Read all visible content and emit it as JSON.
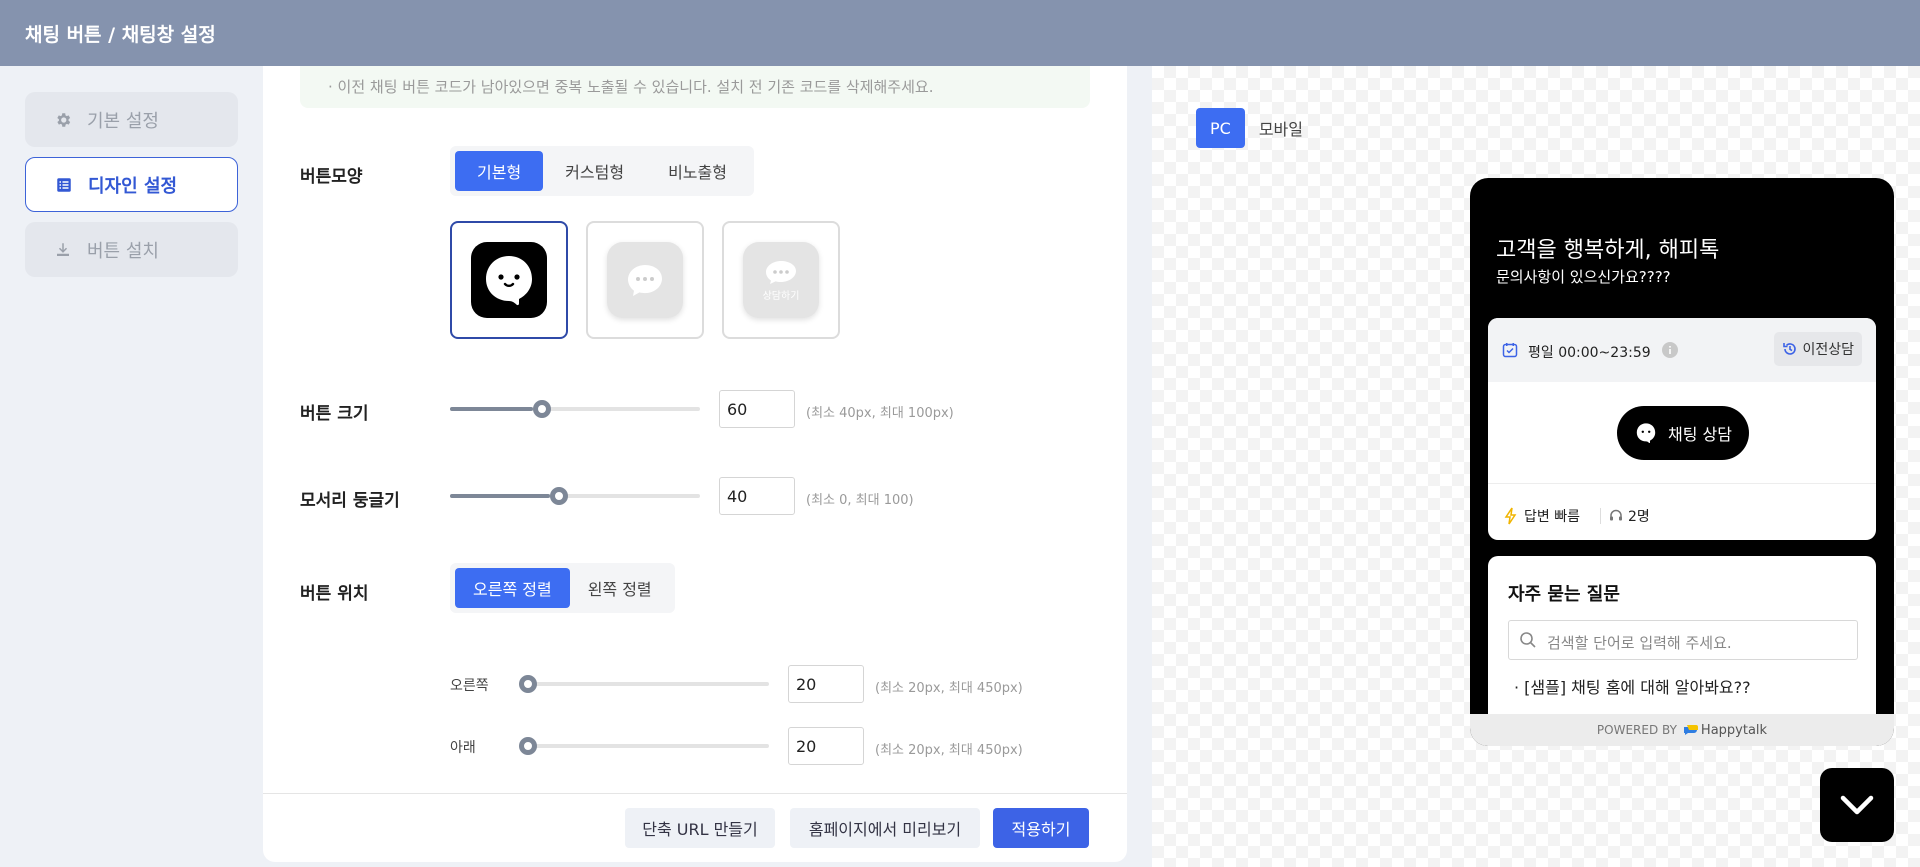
{
  "header": {
    "title": "채팅 버튼 / 채팅창 설정"
  },
  "nav": {
    "items": [
      {
        "label": "기본 설정"
      },
      {
        "label": "디자인 설정"
      },
      {
        "label": "버튼 설치"
      }
    ]
  },
  "notice": {
    "text": "· 이전 채팅 버튼 코드가 남아있으면 중복 노출될 수 있습니다. 설치 전 기존 코드를 삭제해주세요."
  },
  "button_shape": {
    "label": "버튼모양",
    "options": [
      "기본형",
      "커스텀형",
      "비노출형"
    ],
    "selected": "기본형",
    "card_text": "상담하기"
  },
  "button_size": {
    "label": "버튼 크기",
    "value": "60",
    "level": 0.33,
    "hint": "(최소 40px, 최대 100px)"
  },
  "corner_radius": {
    "label": "모서리 둥글기",
    "value": "40",
    "level": 0.4,
    "hint": "(최소 0, 최대 100)"
  },
  "button_position": {
    "label": "버튼 위치",
    "options": [
      "오른쪽 정렬",
      "왼쪽 정렬"
    ],
    "selected": "오른쪽 정렬",
    "right": {
      "label": "오른쪽",
      "value": "20",
      "level": 0.0,
      "hint": "(최소 20px, 최대 450px)"
    },
    "bottom": {
      "label": "아래",
      "value": "20",
      "level": 0.0,
      "hint": "(최소 20px, 최대 450px)"
    }
  },
  "footer": {
    "short_url_label": "단축 URL 만들기",
    "preview_label": "홈페이지에서 미리보기",
    "apply_label": "적용하기"
  },
  "preview": {
    "tabs": [
      "PC",
      "모바일"
    ],
    "widget": {
      "title": "고객을 행복하게, 해피톡",
      "subtitle": "문의사항이 있으신가요????",
      "hours": "평일 00:00~23:59",
      "history_label": "이전상담",
      "chat_button": "채팅 상담",
      "reply_status": "답변 빠름",
      "agents": "2명",
      "faq_title": "자주 묻는 질문",
      "faq_placeholder": "검색할 단어로 입력해 주세요.",
      "faq_item": "· [샘플] 채팅 홈에 대해 알아봐요??",
      "powered_by": "POWERED BY",
      "brand": "Happytalk"
    }
  },
  "colors": {
    "accent": "#3d6df2",
    "header_bg": "#8593ae",
    "nav_active": "#3358d4"
  }
}
